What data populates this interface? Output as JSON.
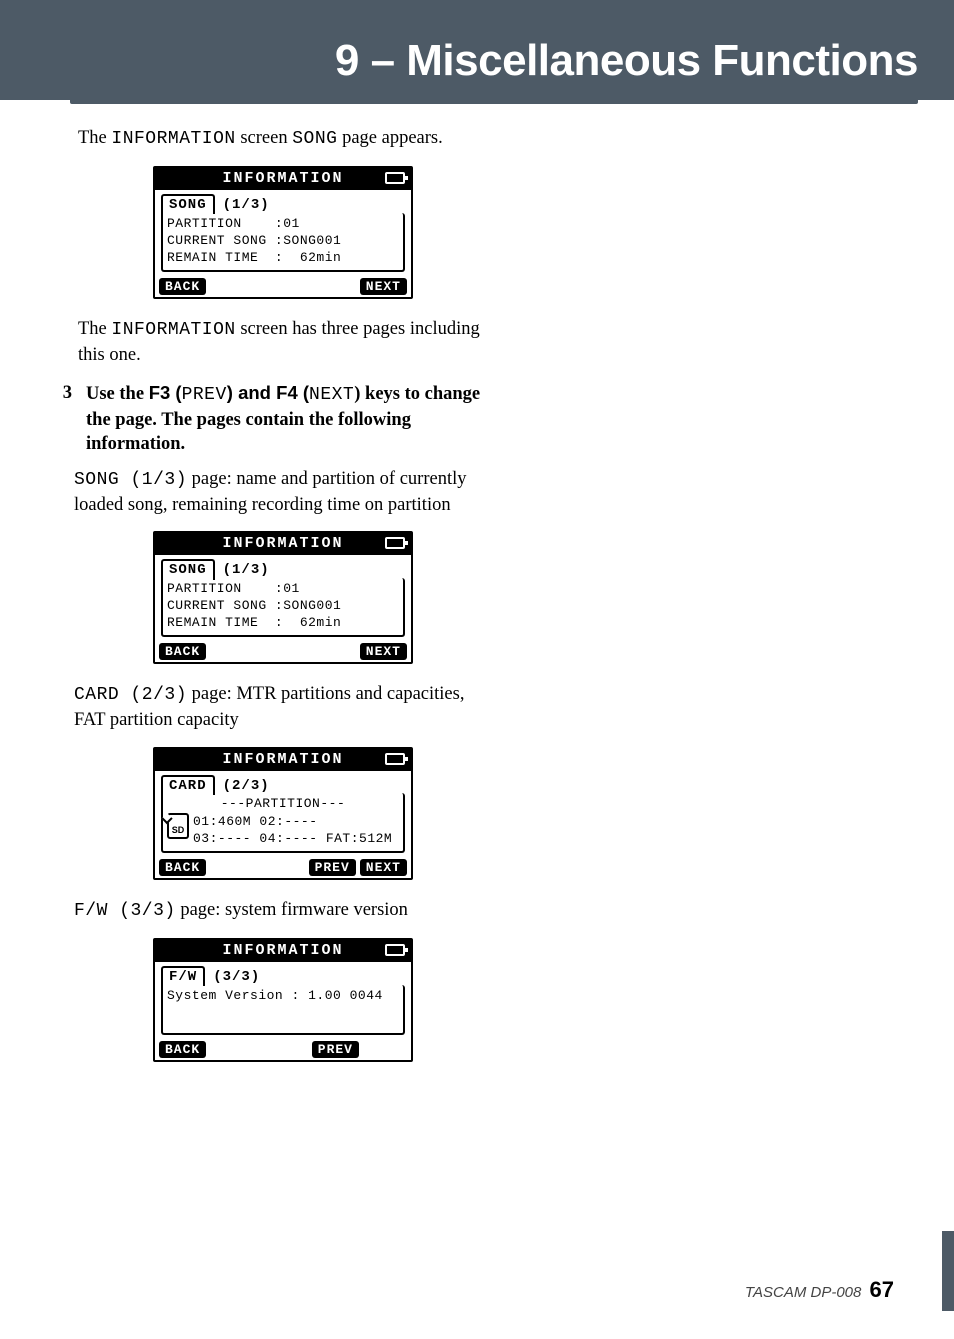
{
  "header": {
    "title": "9 – Miscellaneous Functions"
  },
  "intro": {
    "p1_a": "The ",
    "p1_b": "INFORMATION",
    "p1_c": " screen ",
    "p1_d": "SONG",
    "p1_e": " page appears."
  },
  "lcd1": {
    "title": "INFORMATION",
    "tab": "SONG",
    "page": "(1/3)",
    "line1": "PARTITION    :01",
    "line2": "CURRENT SONG :SONG001",
    "line3": "REMAIN TIME  :  62min",
    "back": "BACK",
    "next": "NEXT"
  },
  "intro2": {
    "a": "The ",
    "b": "INFORMATION",
    "c": " screen has three pages including this one."
  },
  "step3": {
    "num": "3",
    "a": "Use the ",
    "b": "F3 (",
    "c": "PREV",
    "d": ") and ",
    "e": "F4 (",
    "f": "NEXT",
    "g": ") keys to change the page. The pages contain the following information."
  },
  "songpage": {
    "a": "SONG (1/3)",
    "b": " page: name and partition of currently loaded song, remaining recording time on partition"
  },
  "lcd2": {
    "title": "INFORMATION",
    "tab": "SONG",
    "page": "(1/3)",
    "line1": "PARTITION    :01",
    "line2": "CURRENT SONG :SONG001",
    "line3": "REMAIN TIME  :  62min",
    "back": "BACK",
    "next": "NEXT"
  },
  "cardpage": {
    "a": "CARD (2/3)",
    "b": " page: MTR partitions and capacities, FAT partition capacity"
  },
  "lcd3": {
    "title": "INFORMATION",
    "tab": "CARD",
    "page": "(2/3)",
    "box_title": "---PARTITION---",
    "sd": "SD",
    "line1": "01:460M 02:----",
    "line2": "03:---- 04:---- FAT:512M",
    "back": "BACK",
    "prev": "PREV",
    "next": "NEXT"
  },
  "fwpage": {
    "a": "F/W (3/3)",
    "b": " page: system firmware version"
  },
  "lcd4": {
    "title": "INFORMATION",
    "tab": "F/W",
    "page": "(3/3)",
    "line1": "System Version : 1.00 0044",
    "back": "BACK",
    "prev": "PREV"
  },
  "footer": {
    "product": "TASCAM  DP-008",
    "page": "67"
  }
}
